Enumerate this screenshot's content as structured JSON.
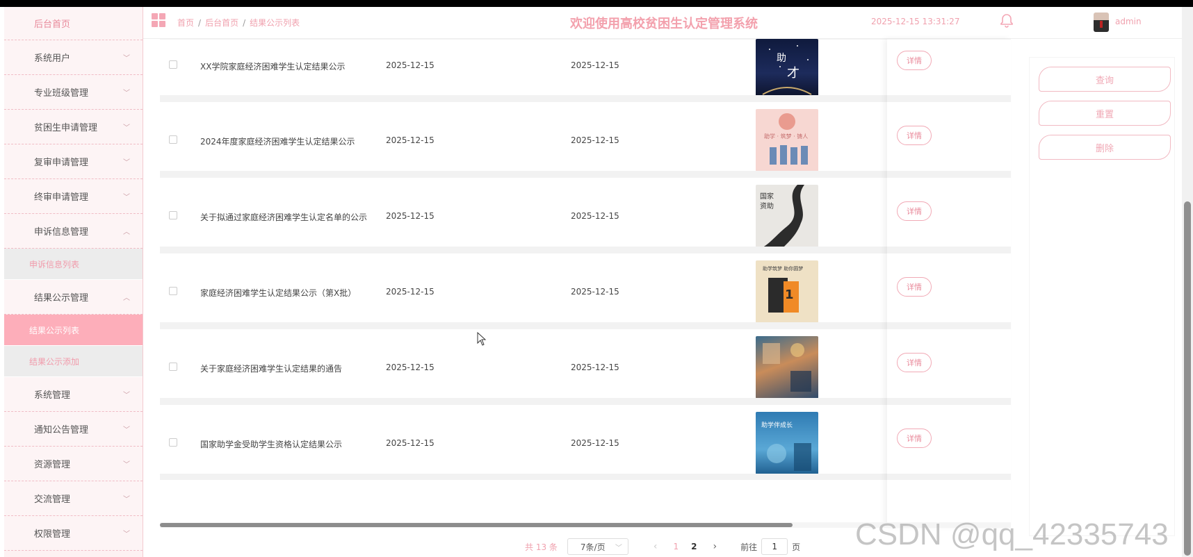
{
  "sidebar": {
    "home": "后台首页",
    "items": [
      {
        "label": "系统用户",
        "chevron": "down"
      },
      {
        "label": "专业班级管理",
        "chevron": "down"
      },
      {
        "label": "贫困生申请管理",
        "chevron": "down"
      },
      {
        "label": "复审申请管理",
        "chevron": "down"
      },
      {
        "label": "终审申请管理",
        "chevron": "down"
      },
      {
        "label": "申诉信息管理",
        "chevron": "up"
      },
      {
        "label": "结果公示管理",
        "chevron": "up"
      },
      {
        "label": "系统管理",
        "chevron": "down"
      },
      {
        "label": "通知公告管理",
        "chevron": "down"
      },
      {
        "label": "资源管理",
        "chevron": "down"
      },
      {
        "label": "交流管理",
        "chevron": "down"
      },
      {
        "label": "权限管理",
        "chevron": "down"
      }
    ],
    "sub_appeal": "申诉信息列表",
    "sub_result_list": "结果公示列表",
    "sub_result_add": "结果公示添加"
  },
  "header": {
    "breadcrumb": [
      "首页",
      "后台首页",
      "结果公示列表"
    ],
    "separator": "/",
    "title": "欢迎使用高校贫困生认定管理系统",
    "datetime": "2025-12-15 13:31:27",
    "username": "admin"
  },
  "table": {
    "detail_label": "详情",
    "rows": [
      {
        "title": "XX学院家庭经济困难学生认定结果公示",
        "date1": "2025-12-15",
        "date2": "2025-12-15"
      },
      {
        "title": "2024年度家庭经济困难学生认定结果公示",
        "date1": "2025-12-15",
        "date2": "2025-12-15"
      },
      {
        "title": "关于拟通过家庭经济困难学生认定名单的公示",
        "date1": "2025-12-15",
        "date2": "2025-12-15"
      },
      {
        "title": "家庭经济困难学生认定结果公示（第X批）",
        "date1": "2025-12-15",
        "date2": "2025-12-15"
      },
      {
        "title": "关于家庭经济困难学生认定结果的通告",
        "date1": "2025-12-15",
        "date2": "2025-12-15"
      },
      {
        "title": "国家助学金受助学生资格认定结果公示",
        "date1": "2025-12-15",
        "date2": "2025-12-15"
      }
    ]
  },
  "right_panel": {
    "query": "查询",
    "reset": "重置",
    "delete": "删除"
  },
  "pagination": {
    "total": "共 13 条",
    "page_size": "7条/页",
    "prev": "‹",
    "next": "›",
    "pages": [
      "1",
      "2"
    ],
    "current_page": "1",
    "jump_label": "前往",
    "jump_value": "1",
    "jump_suffix": "页"
  },
  "watermark": "CSDN @qq_42335743",
  "colors": {
    "accent": "#f3a1ad",
    "active_bg": "#fdaeba"
  }
}
